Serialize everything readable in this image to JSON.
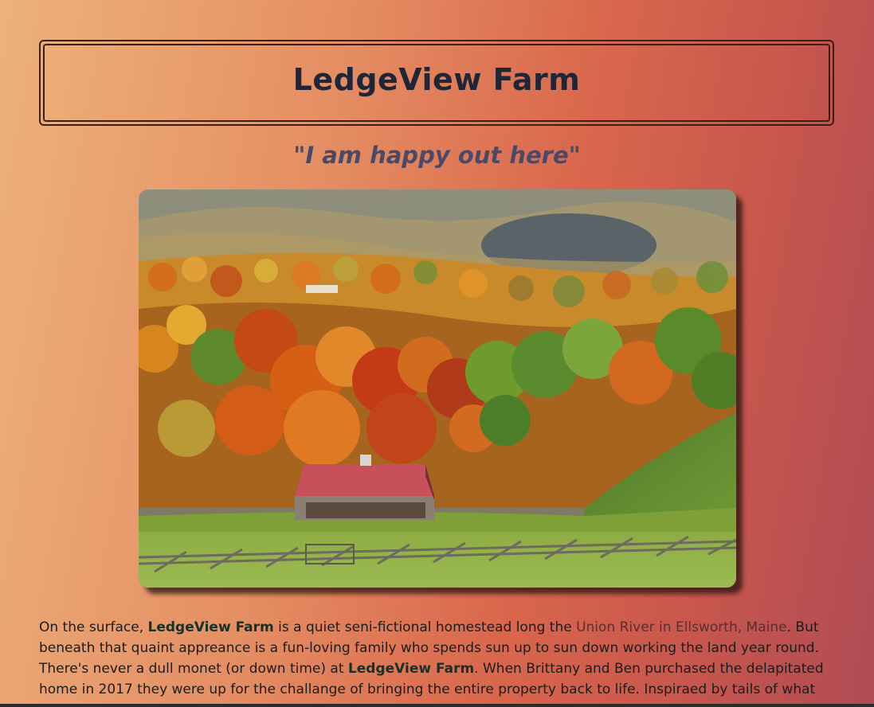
{
  "header": {
    "title": "LedgeView Farm",
    "tagline": "\"I am happy out here\""
  },
  "photo": {
    "subject": "red-roofed barn in autumn valley"
  },
  "intro": {
    "p1": "On the surface, ",
    "farm_name_1": "LedgeView Farm",
    "p2": " is a quiet seni-fictional homestead long the ",
    "location_link": "Union River in Ellsworth, Maine",
    "p3": ". But beneath that quaint appreance is a fun-loving family who spends sun up to sun down working the land year round. There's never a dull monet (or down time) at ",
    "farm_name_2": "LedgeView Farm",
    "p4": ". When Brittany and Ben purchased the delapitated home in 2017 they were up for the challange of bringing the entire property back to life. Inspiraed by tails of what"
  },
  "colors": {
    "title": "#1e2638",
    "tagline": "#4a4a68",
    "border": "#3d1f12",
    "link": "#5a2e2e"
  }
}
